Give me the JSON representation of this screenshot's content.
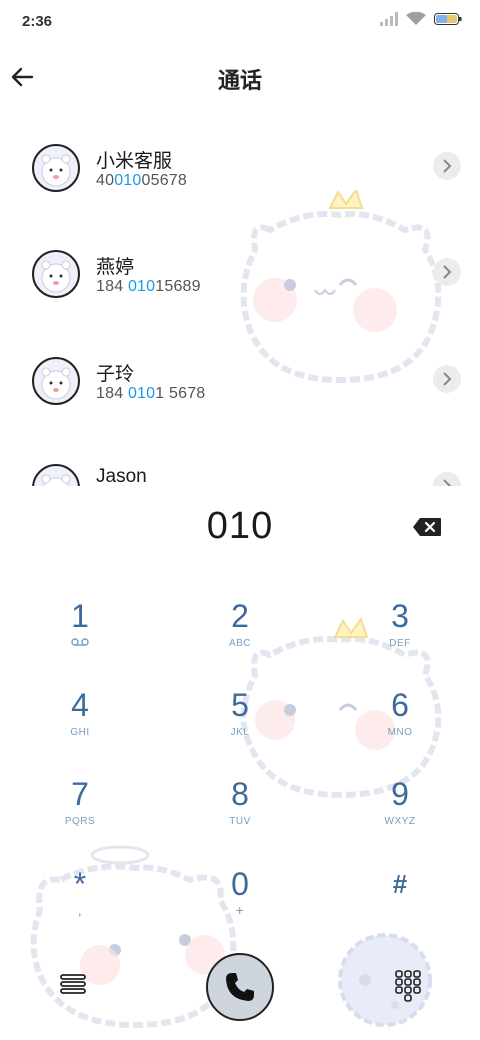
{
  "status_bar": {
    "time": "2:36"
  },
  "header": {
    "title": "通话"
  },
  "contacts": [
    {
      "name": "小米客服",
      "number_pre": "40",
      "number_hl": "010",
      "number_post": "05678"
    },
    {
      "name": "燕婷",
      "number_pre": "184 ",
      "number_hl": "010",
      "number_post": "15689"
    },
    {
      "name": "子玲",
      "number_pre": "184 ",
      "number_hl": "010",
      "number_post": "1 5678"
    },
    {
      "name": "Jason",
      "number_pre": "",
      "number_hl": "",
      "number_post": ""
    }
  ],
  "dialer": {
    "input": "010"
  },
  "keypad": [
    {
      "digit": "1",
      "letters": ""
    },
    {
      "digit": "2",
      "letters": "ABC"
    },
    {
      "digit": "3",
      "letters": "DEF"
    },
    {
      "digit": "4",
      "letters": "GHI"
    },
    {
      "digit": "5",
      "letters": "JKL"
    },
    {
      "digit": "6",
      "letters": "MNO"
    },
    {
      "digit": "7",
      "letters": "PQRS"
    },
    {
      "digit": "8",
      "letters": "TUV"
    },
    {
      "digit": "9",
      "letters": "WXYZ"
    },
    {
      "digit": "*",
      "letters": ","
    },
    {
      "digit": "0",
      "letters": "+"
    },
    {
      "digit": "#",
      "letters": ""
    }
  ],
  "colors": {
    "accent": "#1a9be6",
    "key_digit": "#3d6a9a",
    "key_letters": "#7a9cbf"
  }
}
